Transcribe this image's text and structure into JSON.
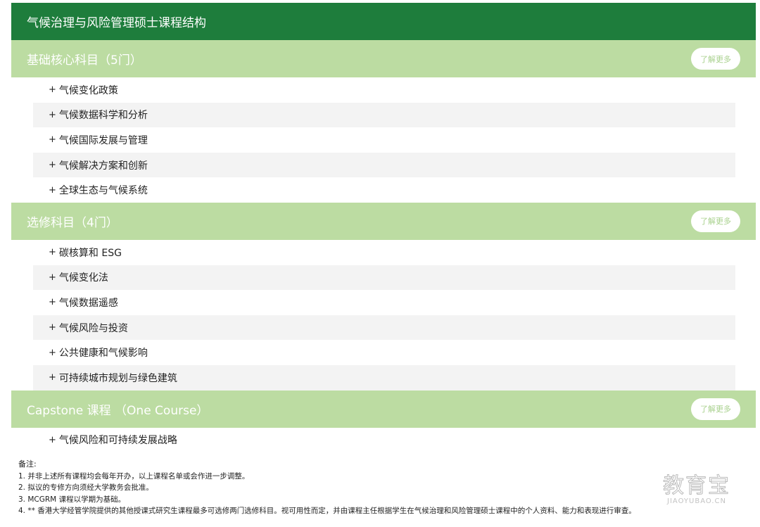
{
  "title": "气候治理与风险管理硕士课程结构",
  "sections": [
    {
      "heading": "基础核心科目（5门）",
      "more_label": "了解更多",
      "courses": [
        "气候变化政策",
        "气候数据科学和分析",
        "气候国际发展与管理",
        "气候解决方案和创新",
        "全球生态与气候系统"
      ]
    },
    {
      "heading": "选修科目（4门）",
      "more_label": "了解更多",
      "courses": [
        "碳核算和 ESG",
        "气候变化法",
        "气候数据遥感",
        "气候风险与投资",
        "公共健康和气候影响",
        "可持续城市规划与绿色建筑"
      ]
    },
    {
      "heading": "Capstone 课程 （One Course）",
      "more_label": "了解更多",
      "courses": [
        "气候风险和可持续发展战略"
      ]
    }
  ],
  "notes": {
    "title": "备注:",
    "items": [
      "1. 并非上述所有课程均会每年开办，以上课程名单或会作进一步调整。",
      "2. 拟议的专修方向须经大学教务会批准。",
      "3. MCGRM 课程以学期为基础。",
      "4. ** 香港大学经管学院提供的其他授课式研究生课程最多可选修两门选修科目。视可用性而定，并由课程主任根据学生在气候治理和风险管理硕士课程中的个人资料、能力和表现进行审查。"
    ]
  },
  "watermark": {
    "main": "教育宝",
    "sub": "JIAOYUBAO.CN"
  }
}
